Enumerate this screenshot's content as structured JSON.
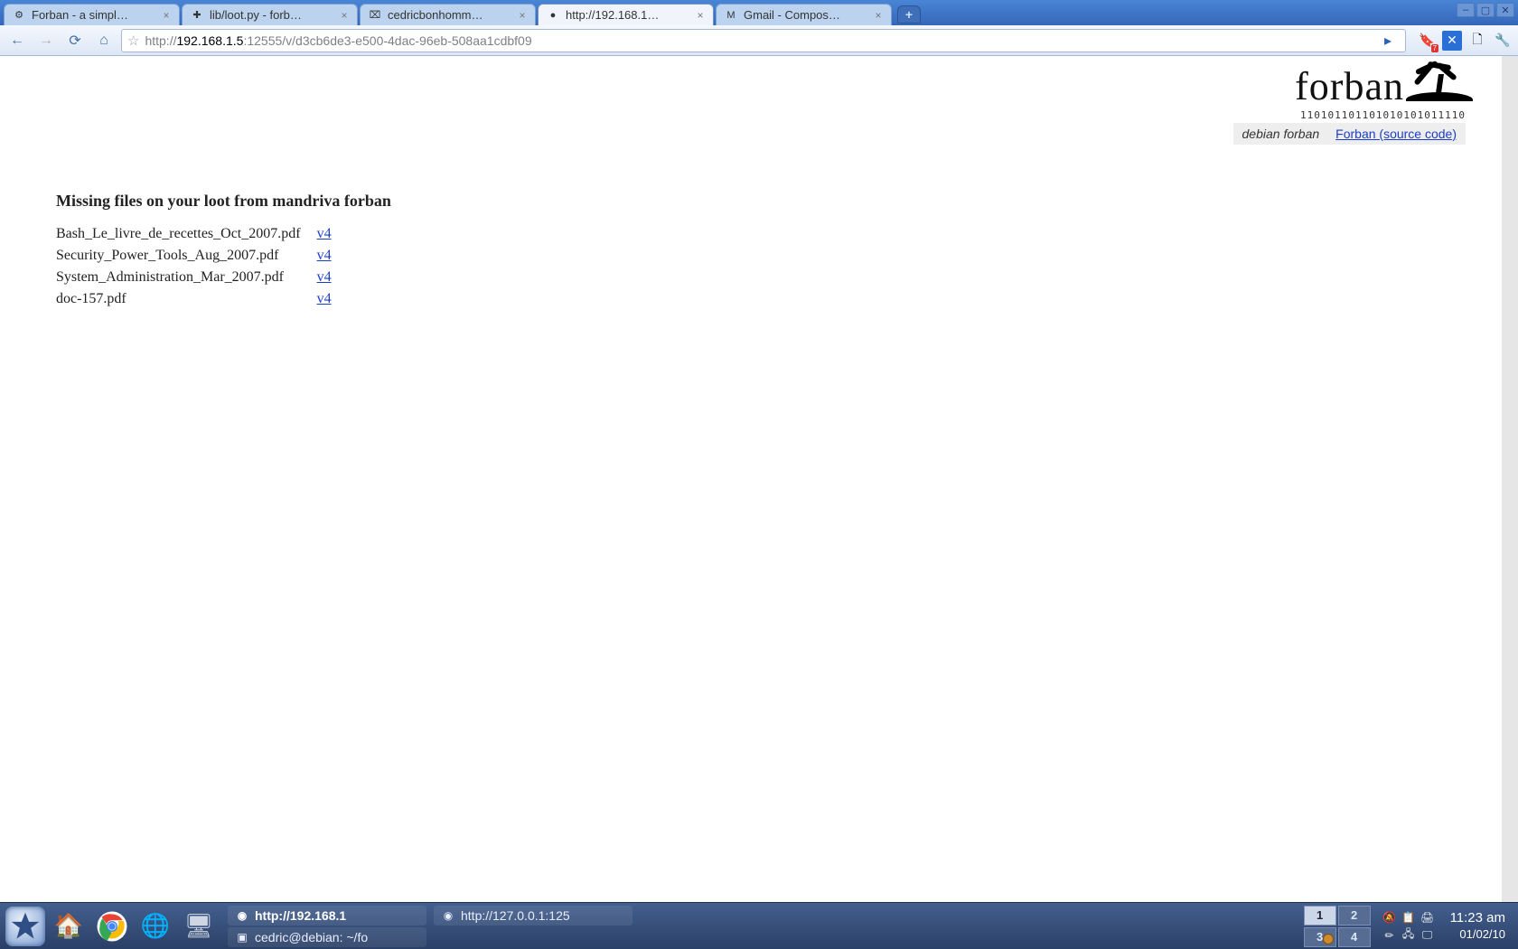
{
  "window": {
    "controls": {
      "min": "–",
      "max": "▢",
      "close": "✕"
    }
  },
  "tabs": [
    {
      "title": "Forban - a simpl…",
      "active": false,
      "favicon": "⚙"
    },
    {
      "title": "lib/loot.py - forb…",
      "active": false,
      "favicon": "✚"
    },
    {
      "title": "cedricbonhomm…",
      "active": false,
      "favicon": "⌧"
    },
    {
      "title": "http://192.168.1…",
      "active": true,
      "favicon": "●"
    },
    {
      "title": "Gmail - Compos…",
      "active": false,
      "favicon": "M"
    }
  ],
  "newtab_label": "+",
  "toolbar": {
    "back": "←",
    "forward": "→",
    "reload": "⟳",
    "home": "⌂",
    "star": "☆",
    "url_prefix": "http://",
    "url_host": "192.168.1.5",
    "url_suffix": ":12555/v/d3cb6de3-e500-4dac-96eb-508aa1cdbf09",
    "play": "▸",
    "icons": [
      "🔖",
      "✕",
      "🗋",
      "🔧"
    ]
  },
  "header": {
    "logo_text": "forban",
    "binary": "110101101101010101011110",
    "subhead_instance": "debian forban",
    "subhead_link": "Forban (source code)"
  },
  "page": {
    "heading": "Missing files on your loot from mandriva forban",
    "link_label": "v4",
    "files": [
      {
        "name": "Bash_Le_livre_de_recettes_Oct_2007.pdf"
      },
      {
        "name": "Security_Power_Tools_Aug_2007.pdf"
      },
      {
        "name": "System_Administration_Mar_2007.pdf"
      },
      {
        "name": "doc-157.pdf"
      }
    ]
  },
  "taskbar": {
    "entries": [
      {
        "label": "http://192.168.1",
        "bold": true,
        "icon": "◉"
      },
      {
        "label": "cedric@debian: ~/fo",
        "bold": false,
        "icon": "▣"
      },
      {
        "label": "http://127.0.0.1:125",
        "bold": false,
        "icon": "◉",
        "row": 0,
        "col": 1
      }
    ],
    "pager": [
      "1",
      "2",
      "3",
      "4"
    ],
    "time": "11:23 am",
    "date": "01/02/10"
  }
}
